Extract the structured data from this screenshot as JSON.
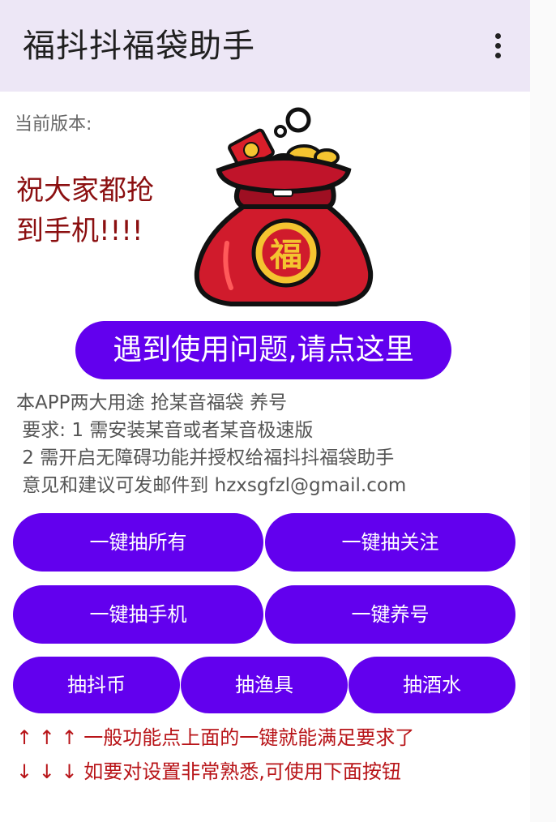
{
  "app_bar": {
    "title": "福抖抖福袋助手",
    "menu_icon": "more-vert-icon"
  },
  "header": {
    "version_label": "当前版本:",
    "greeting_line1": "祝大家都抢",
    "greeting_line2": "到手机!!!!",
    "bag_icon": "lucky-bag-icon",
    "bag_character": "福"
  },
  "help_button_label": "遇到使用问题,请点这里",
  "info_lines": [
    "本APP两大用途 抢某音福袋 养号",
    " 要求: 1 需安装某音或者某音极速版",
    " 2 需开启无障碍功能并授权给福抖抖福袋助手",
    " 意见和建议可发邮件到 hzxsgfzl@gmail.com"
  ],
  "buttons": {
    "grab_all": "一键抽所有",
    "grab_follow": "一键抽关注",
    "grab_phone": "一键抽手机",
    "keep_account": "一键养号",
    "grab_coins": "抽抖币",
    "grab_fishing": "抽渔具",
    "grab_drinks": "抽酒水"
  },
  "hints": {
    "up": "↑ ↑ ↑ 一般功能点上面的一键就能满足要求了",
    "down": "↓ ↓ ↓ 如要对设置非常熟悉,可使用下面按钮"
  },
  "colors": {
    "accent": "#6200ee",
    "app_bar": "#ede7f6",
    "greeting": "#8b0f10",
    "hint": "#b81418"
  }
}
